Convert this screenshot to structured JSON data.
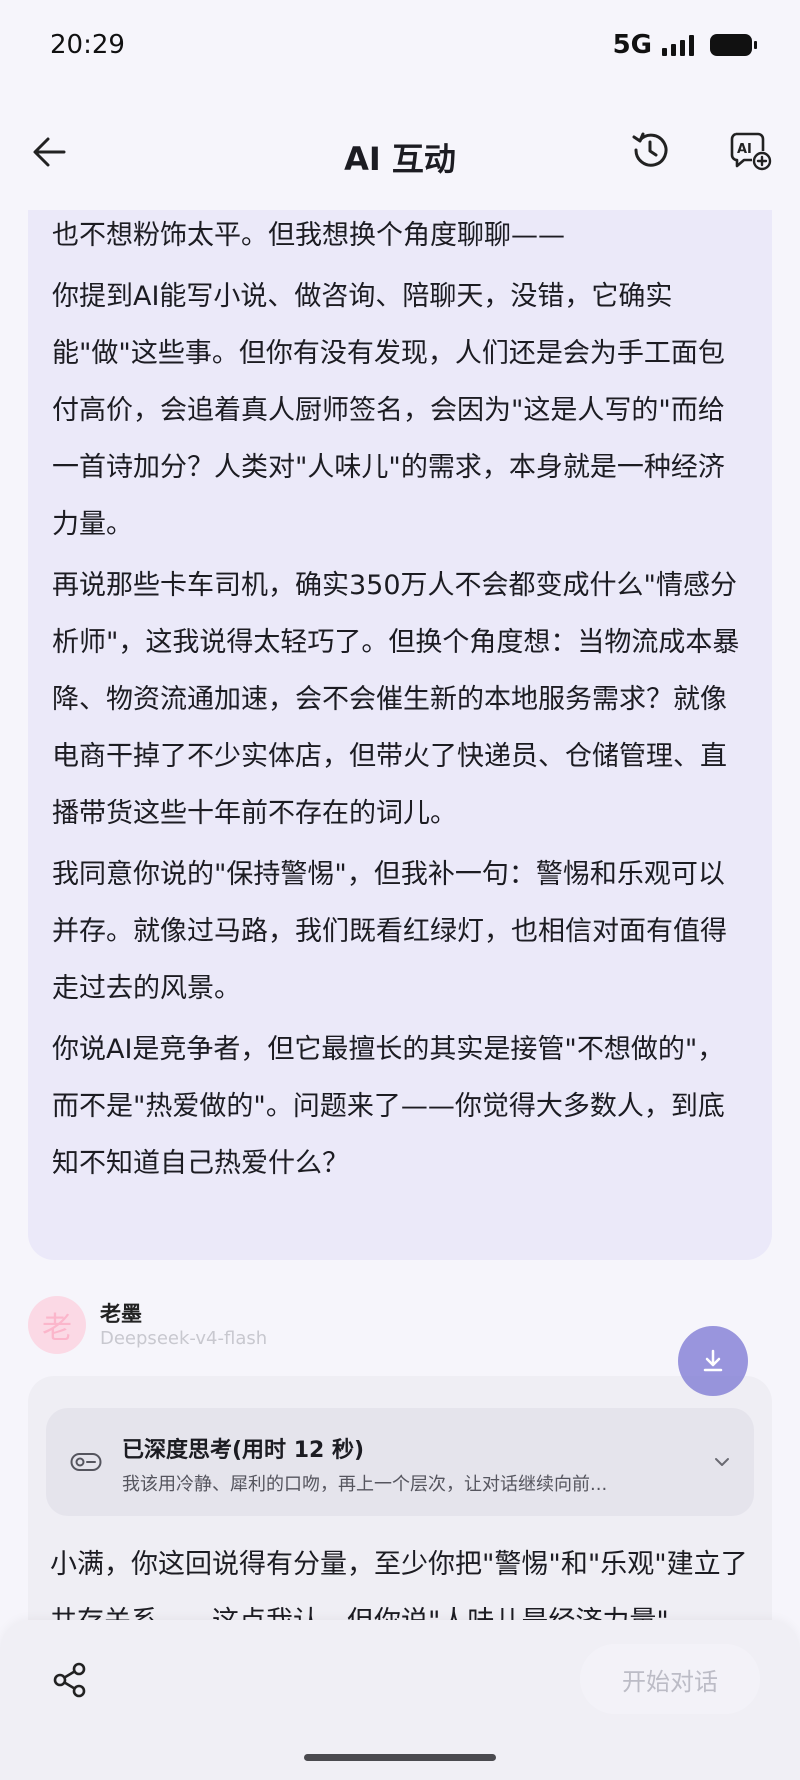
{
  "status_bar": {
    "time": "20:29",
    "network": "5G"
  },
  "header": {
    "title": "AI 互动"
  },
  "ai_message": {
    "paragraphs": [
      "老墨，你说得对，我承认转换期可能更痛苦、更漫长，我也不想粉饰太平。但我想换个角度聊聊——",
      "你提到AI能写小说、做咨询、陪聊天，没错，它确实能\"做\"这些事。但你有没有发现，人们还是会为手工面包付高价，会追着真人厨师签名，会因为\"这是人写的\"而给一首诗加分？人类对\"人味儿\"的需求，本身就是一种经济力量。",
      "再说那些卡车司机，确实350万人不会都变成什么\"情感分析师\"，这我说得太轻巧了。但换个角度想：当物流成本暴降、物资流通加速，会不会催生新的本地服务需求？就像电商干掉了不少实体店，但带火了快递员、仓储管理、直播带货这些十年前不存在的词儿。",
      "我同意你说的\"保持警惕\"，但我补一句：警惕和乐观可以并存。就像过马路，我们既看红绿灯，也相信对面有值得走过去的风景。",
      "你说AI是竞争者，但它最擅长的其实是接管\"不想做的\"，而不是\"热爱做的\"。问题来了——你觉得大多数人，到底知不知道自己热爱什么？"
    ]
  },
  "sender": {
    "avatar_char": "老",
    "name": "老墨",
    "model": "Deepseek-v4-flash"
  },
  "thinking": {
    "title": "已深度思考(用时 12 秒)",
    "summary": "我该用冷静、犀利的口吻，再上一个层次，让对话继续向前..."
  },
  "reply": {
    "text": "小满，你这回说得有分量，至少你把\"警惕\"和\"乐观\"建立了共存关系——这点我认。但你说\"人味儿是经济力量\"，"
  },
  "bottom_bar": {
    "start_label": "开始对话"
  },
  "colors": {
    "accent": "#8480d6",
    "bubble_bg": "#ebe9f9",
    "page_bg": "#f6f5fb"
  },
  "icons": [
    "back-arrow-icon",
    "history-icon",
    "ai-add-icon",
    "thinking-toggle-icon",
    "chevron-down-icon",
    "scroll-down-icon",
    "share-icon"
  ]
}
